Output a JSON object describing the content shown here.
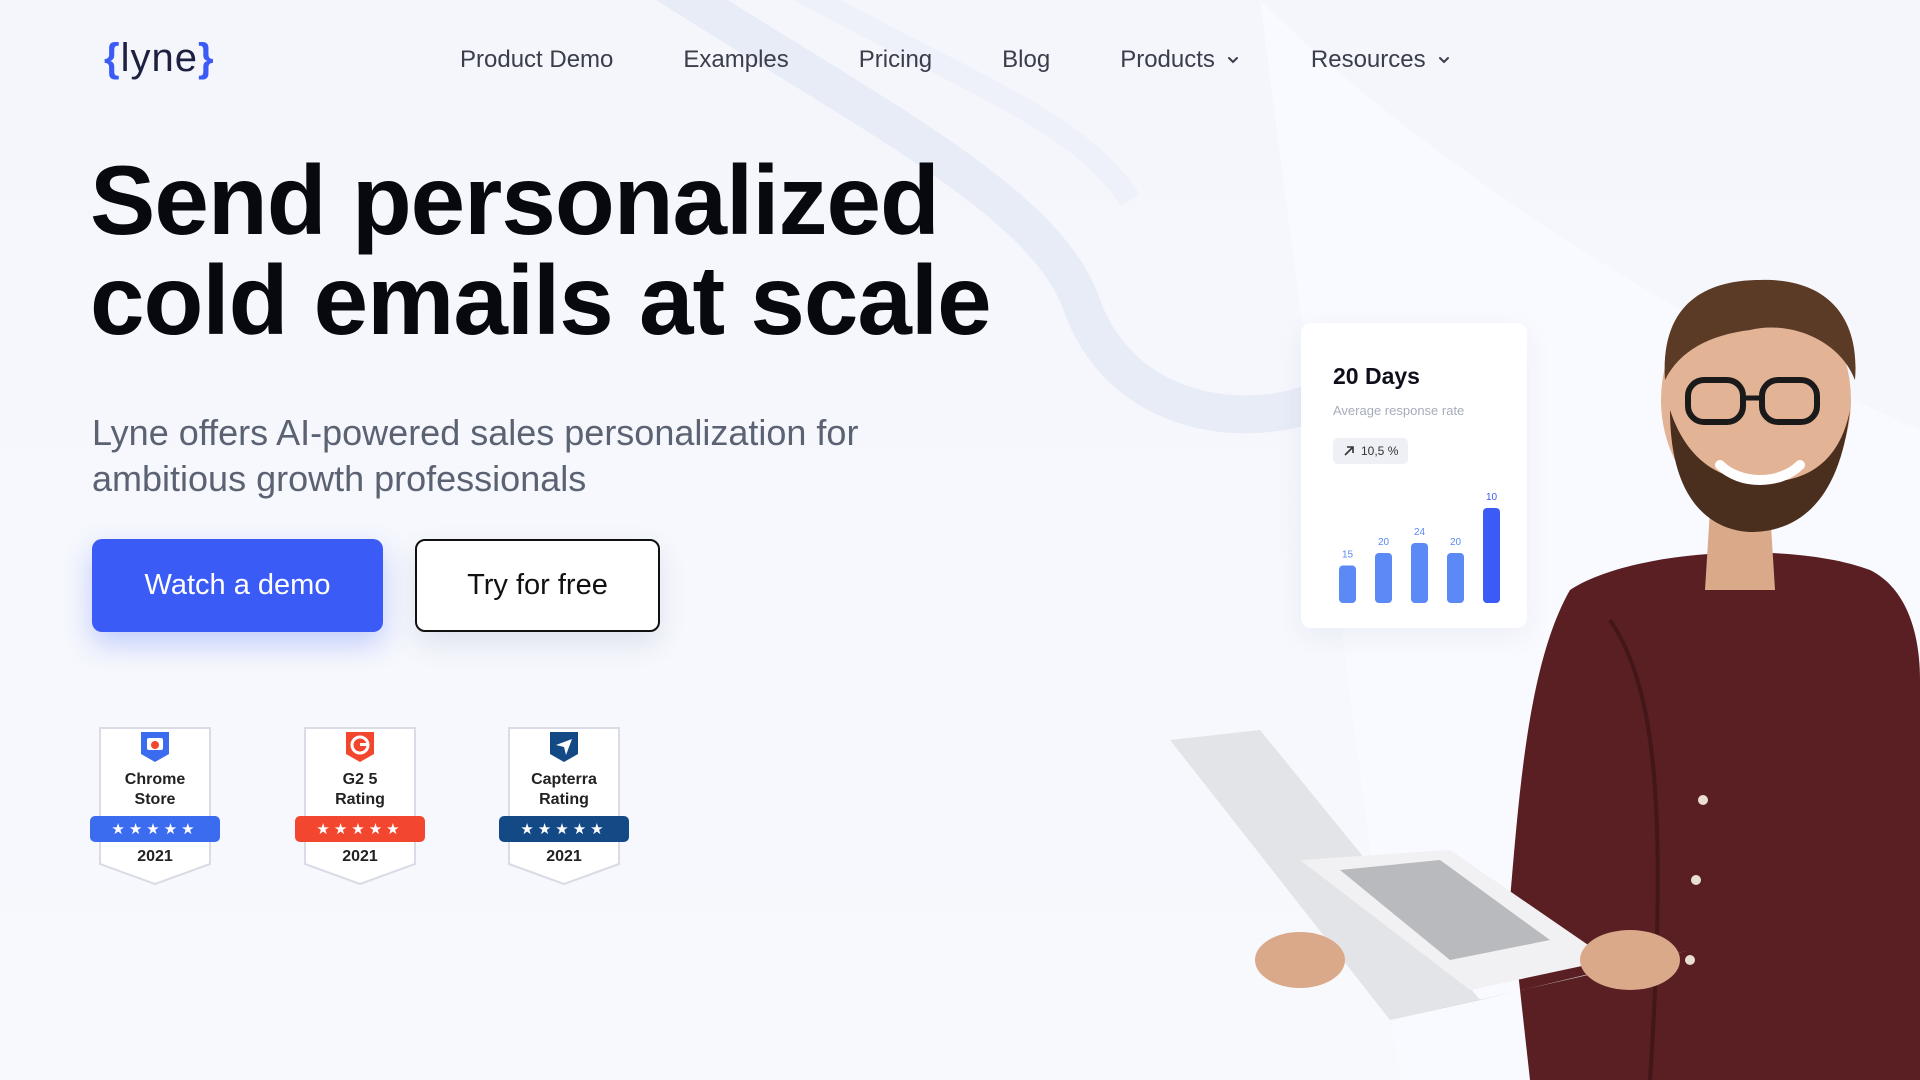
{
  "logo": {
    "open": "{",
    "text": "lyne",
    "close": "}"
  },
  "nav": {
    "items": [
      {
        "label": "Product Demo"
      },
      {
        "label": "Examples"
      },
      {
        "label": "Pricing"
      },
      {
        "label": "Blog"
      },
      {
        "label": "Products",
        "dropdown": true
      },
      {
        "label": "Resources",
        "dropdown": true
      }
    ]
  },
  "hero": {
    "headline_line1": "Send personalized",
    "headline_line2": "cold emails at scale",
    "subhead": "Lyne offers AI-powered sales personalization for ambitious growth professionals",
    "primary_button": "Watch a demo",
    "secondary_button": "Try for free"
  },
  "badges": [
    {
      "title_line1": "Chrome",
      "title_line2": "Store",
      "stars": "★★★★★",
      "year": "2021",
      "color": "#3b6cf0",
      "icon": "chrome-store-icon"
    },
    {
      "title_line1": "G2 5",
      "title_line2": "Rating",
      "stars": "★★★★★",
      "year": "2021",
      "color": "#f2472e",
      "icon": "g2-icon"
    },
    {
      "title_line1": "Capterra",
      "title_line2": "Rating",
      "stars": "★★★★★",
      "year": "2021",
      "color": "#134a86",
      "icon": "capterra-icon"
    }
  ],
  "stats_card": {
    "title": "20 Days",
    "subtitle": "Average response rate",
    "change": "10,5 %",
    "change_icon": "arrow-up-right-icon"
  },
  "chart_data": {
    "type": "bar",
    "categories": [
      "",
      "",
      "",
      "",
      ""
    ],
    "values": [
      15,
      20,
      24,
      20,
      10
    ],
    "data_labels": [
      "15",
      "20",
      "24",
      "20",
      "10"
    ],
    "highlight_index": 4,
    "colors": {
      "normal": "#5b8af7",
      "highlight": "#3b5bf7"
    },
    "title": "",
    "xlabel": "",
    "ylabel": ""
  },
  "colors": {
    "accent": "#3b5bf7",
    "text": "#0b0b14",
    "subtext": "#5b6272"
  }
}
